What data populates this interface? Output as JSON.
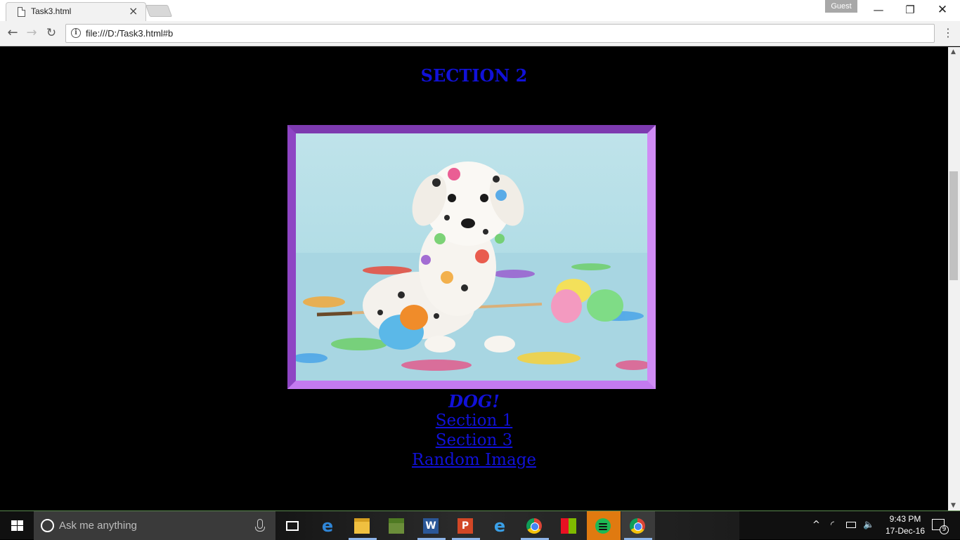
{
  "browser": {
    "tab_title": "Task3.html",
    "tab_close": "×",
    "profile_badge": "Guest",
    "window_controls": {
      "minimize": "—",
      "maximize": "❐",
      "close": "✕"
    },
    "url": "file:///D:/Task3.html#b",
    "nav": {
      "back": "←",
      "forward": "→",
      "reload": "↻",
      "menu": "⋮"
    }
  },
  "page": {
    "heading": "SECTION 2",
    "image_alt": "DOG!",
    "caption": "DOG!",
    "links": [
      {
        "label": "Section 1"
      },
      {
        "label": "Section 3"
      },
      {
        "label": "Random Image"
      }
    ],
    "link_color": "#1111d8",
    "frame_color": "#b565e6"
  },
  "taskbar": {
    "search_placeholder": "Ask me anything",
    "apps": [
      "task-view",
      "edge",
      "file-explorer",
      "minecraft",
      "word",
      "powerpoint",
      "internet-explorer",
      "chrome",
      "windows-tiles",
      "spotify",
      "chrome"
    ],
    "tray": {
      "chevron": "^",
      "wifi": "◜",
      "volume": "🔈",
      "time": "9:43 PM",
      "date": "17-Dec-16",
      "notification_count": "9"
    }
  }
}
